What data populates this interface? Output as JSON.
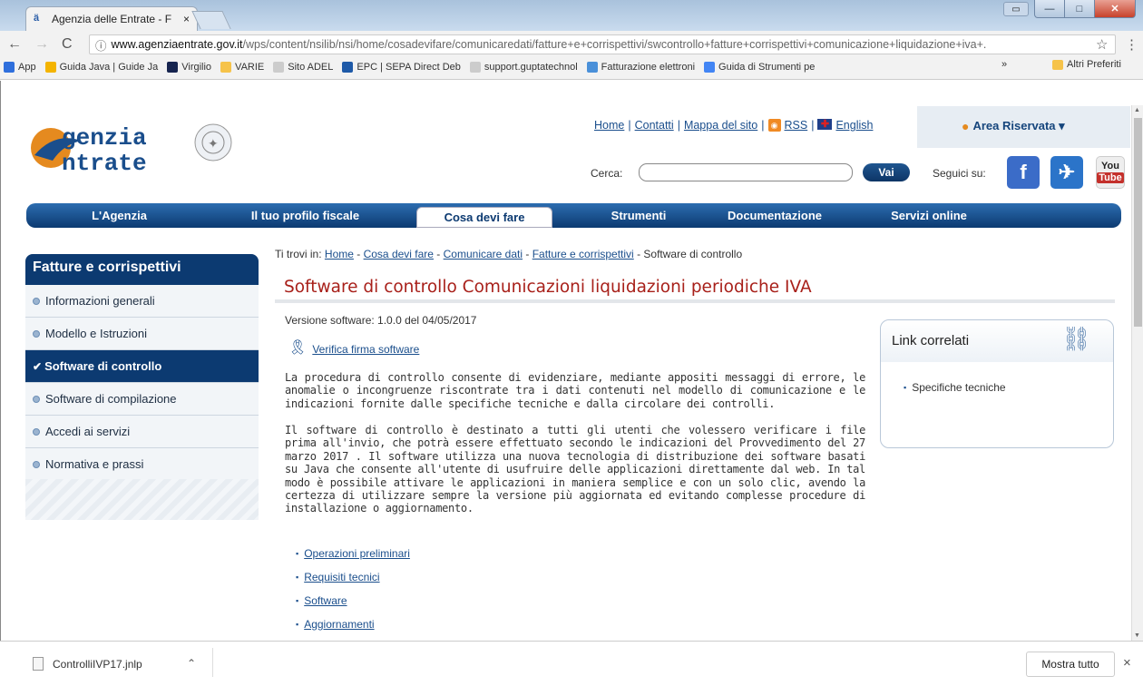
{
  "browser": {
    "tab_title": "Agenzia delle Entrate - F",
    "tab_close": "×",
    "url_host": "www.agenziaentrate.gov.it",
    "url_path": "/wps/content/nsilib/nsi/home/cosadevifare/comunicaredati/fatture+e+corrispettivi/swcontrollo+fatture+corrispettivi+comunicazione+liquidazione+iva+.",
    "bookmarks": [
      {
        "label": "App",
        "color": "#2f6fdc"
      },
      {
        "label": "Guida Java | Guide Ja",
        "color": "#f4b400"
      },
      {
        "label": "Virgilio",
        "color": "#16244f"
      },
      {
        "label": "VARIE",
        "color": "#f6c34a"
      },
      {
        "label": "Sito ADEL",
        "color": "#cccccc"
      },
      {
        "label": "EPC | SEPA Direct Deb",
        "color": "#1e5aa8"
      },
      {
        "label": "support.guptatechnol",
        "color": "#cccccc"
      },
      {
        "label": "Fatturazione elettroni",
        "color": "#4a90d9"
      },
      {
        "label": "Guida di Strumenti pe",
        "color": "#4285f4"
      }
    ],
    "bookmarks_more": "»",
    "other_bookmarks": "Altri Preferiti"
  },
  "site": {
    "logo_line1": "genzia",
    "logo_line2": "ntrate",
    "top_links": [
      "Home",
      "Contatti",
      "Mappa del sito",
      "RSS",
      "English"
    ],
    "area_riservata": "Area Riservata ▾",
    "search_label": "Cerca:",
    "search_button": "Vai",
    "seguici": "Seguici su:",
    "youtube_top": "You",
    "youtube_bottom": "Tube",
    "main_nav": [
      {
        "label": "L'Agenzia",
        "active": false
      },
      {
        "label": "Il tuo profilo fiscale",
        "active": false
      },
      {
        "label": "Cosa devi fare",
        "active": true
      },
      {
        "label": "Strumenti",
        "active": false
      },
      {
        "label": "Documentazione",
        "active": false
      },
      {
        "label": "Servizi online",
        "active": false
      }
    ]
  },
  "sidebar": {
    "title": "Fatture e corrispettivi",
    "items": [
      {
        "label": "Informazioni generali",
        "active": false
      },
      {
        "label": "Modello e Istruzioni",
        "active": false
      },
      {
        "label": "Software di controllo",
        "active": true
      },
      {
        "label": "Software di compilazione",
        "active": false
      },
      {
        "label": "Accedi ai servizi",
        "active": false
      },
      {
        "label": "Normativa e prassi",
        "active": false
      }
    ]
  },
  "content": {
    "breadcrumb_prefix": "Ti trovi in:",
    "breadcrumb": [
      "Home",
      "Cosa devi fare",
      "Comunicare dati",
      "Fatture e corrispettivi"
    ],
    "breadcrumb_current": "Software di controllo",
    "title": "Software di controllo Comunicazioni liquidazioni periodiche IVA",
    "version": "Versione software: 1.0.0 del 04/05/2017",
    "verify_link": "Verifica firma software",
    "paragraph1": "La procedura di controllo consente di evidenziare, mediante appositi messaggi di errore, le anomalie o incongruenze riscontrate tra i dati contenuti nel modello di comunicazione e le indicazioni fornite dalle specifiche tecniche e dalla circolare dei controlli.",
    "paragraph2": "Il software di controllo è destinato a tutti gli utenti che volessero verificare i file prima all'invio, che potrà essere effettuato secondo le indicazioni del Provvedimento del 27 marzo 2017 . Il software utilizza una nuova tecnologia di distribuzione dei software basati su Java che consente all'utente di usufruire delle applicazioni direttamente dal web. In tal modo è possibile attivare le applicazioni in maniera semplice e con un solo clic, avendo la certezza di utilizzare sempre la versione più aggiornata ed evitando complesse procedure di installazione o aggiornamento.",
    "doc_links": [
      "Operazioni preliminari",
      "Requisiti tecnici",
      "Software",
      "Aggiornamenti"
    ]
  },
  "related": {
    "title": "Link correlati",
    "links": [
      "Specifiche tecniche"
    ]
  },
  "downloads": {
    "file": "ControlliIVP17.jnlp",
    "show_all": "Mostra tutto",
    "close": "×"
  }
}
